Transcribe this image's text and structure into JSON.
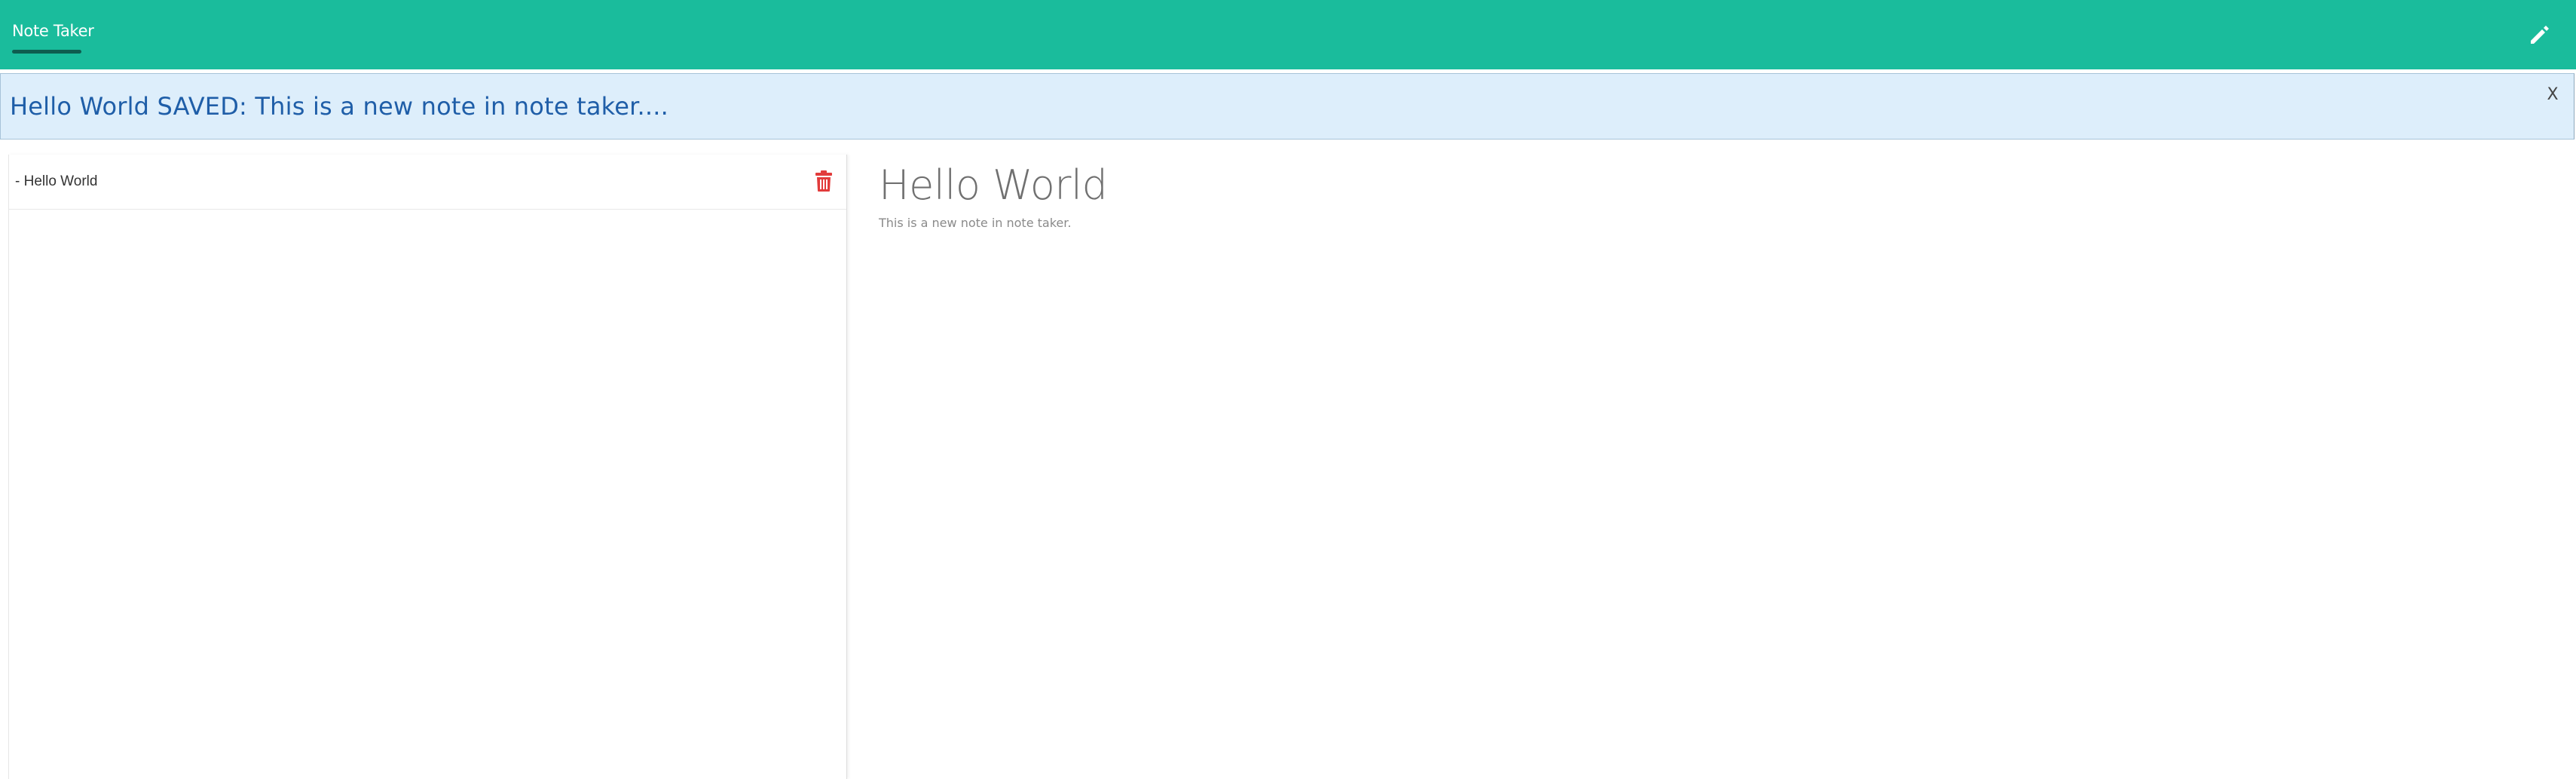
{
  "navbar": {
    "brand": "Note Taker",
    "edit_icon": "pencil-icon",
    "background": "#1abc9c"
  },
  "alert": {
    "message": "Hello World SAVED: This is a new note in note taker....",
    "close_label": "X",
    "background": "#ddeefb",
    "text_color": "#1f5ea8"
  },
  "sidebar": {
    "notes": [
      {
        "label": "- Hello World",
        "delete_icon": "trash-icon",
        "delete_color": "#e23b3b"
      }
    ]
  },
  "content": {
    "title": "Hello World",
    "body": "This is a new note in note taker."
  }
}
